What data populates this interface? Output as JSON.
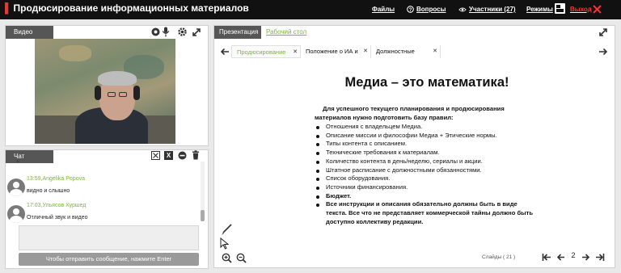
{
  "header": {
    "title": "Продюсирование информационных материалов",
    "files": "Файлы",
    "questions": "Вопросы",
    "participants": "Участники (27)",
    "modes": "Режимы",
    "exit": "Выход"
  },
  "video_panel": {
    "tab": "Видео"
  },
  "chat_panel": {
    "tab": "Чат",
    "messages": [
      {
        "time": "13:59,",
        "name": "Angelika Popova",
        "text": "видно и слышно"
      },
      {
        "time": "17:03,",
        "name": "Ульясов Хуршед",
        "text": "Отличный звук и видео"
      }
    ],
    "send_hint": "Чтобы отправить сообщение, нажмите Enter"
  },
  "presentation": {
    "tab_active": "Презентация",
    "tab_desktop": "Рабочий стол",
    "doc_tabs": [
      "Продюсирование",
      "Положение о ИА и",
      "Должностные"
    ],
    "slide": {
      "title": "Медиа – это математика!",
      "intro": "Для успешного текущего планирования и продюсирования материалов нужно подготовить базу правил:",
      "items": [
        "Отношения с владельцем Медиа.",
        "Описание миссии и философии Медиа + Этические нормы.",
        "Типы контента с описанием.",
        "Технические требования к материалам.",
        "Количество  контента в день/неделю, сериалы и акции.",
        "Штатное расписание с должностными обязанностями.",
        "Список оборудования.",
        "Источники финансирования."
      ],
      "bold_items": [
        "Бюджет.",
        "Все инструкции и описания обязательно должны быть  в  виде текста. Все что не представляет коммерческой тайны должно быть доступно коллективу редакции."
      ]
    },
    "slides_label": "Слайды (",
    "slides_count": "21",
    "slides_close": ")",
    "current_slide": "2"
  },
  "colors": {
    "accent_green": "#7cb342",
    "exit_red": "#e53935",
    "topbar": "#111111"
  },
  "icons": [
    "record-icon",
    "mic-icon",
    "gear-icon",
    "expand-icon",
    "close-box-icon",
    "excel-icon",
    "minus-circle-icon",
    "trash-icon",
    "pen-icon",
    "cursor-icon",
    "zoom-in-icon",
    "zoom-out-icon",
    "first-page-icon",
    "prev-page-icon",
    "next-page-icon",
    "last-page-icon"
  ]
}
